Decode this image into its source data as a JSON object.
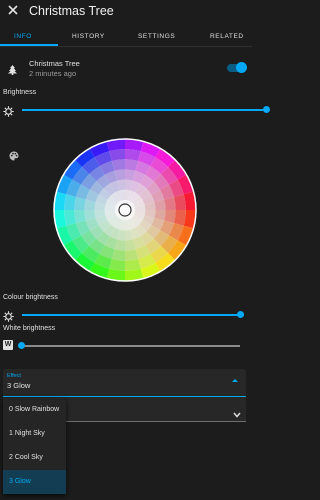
{
  "header": {
    "title": "Christmas Tree",
    "close_icon": "close-icon"
  },
  "tabs": [
    {
      "label": "INFO",
      "active": true
    },
    {
      "label": "HISTORY",
      "active": false
    },
    {
      "label": "SETTINGS",
      "active": false
    },
    {
      "label": "RELATED",
      "active": false
    }
  ],
  "entity": {
    "name": "Christmas Tree",
    "last_changed": "2 minutes ago",
    "state_on": true
  },
  "brightness": {
    "label": "Brightness",
    "value": 1.0
  },
  "colour_brightness": {
    "label": "Colour brightness",
    "value": 1.0
  },
  "white_brightness": {
    "label": "White brightness",
    "value": 0.0,
    "badge": "W"
  },
  "effect": {
    "label": "Effect",
    "value": "3 Glow",
    "options": [
      "0 Slow Rainbow",
      "1 Night Sky",
      "2 Cool Sky",
      "3 Glow"
    ],
    "selected_index": 3
  },
  "colors": {
    "accent": "#03a9f4",
    "background": "#1c1c1c",
    "surface": "#272727"
  }
}
